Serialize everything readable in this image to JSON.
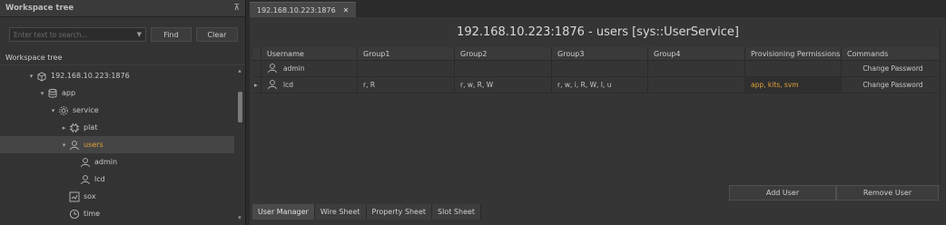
{
  "left_panel": {
    "title": "Workspace tree",
    "pin_icon": "pin-icon",
    "search": {
      "placeholder": "Enter text to search...",
      "find_label": "Find",
      "clear_label": "Clear"
    },
    "tree_header": "Workspace tree",
    "tree": [
      {
        "label": "192.168.10.223:1876",
        "icon": "device-icon",
        "expanded": true,
        "level": 0
      },
      {
        "label": "app",
        "icon": "database-icon",
        "expanded": true,
        "level": 1
      },
      {
        "label": "service",
        "icon": "gear-icon",
        "expanded": true,
        "level": 2
      },
      {
        "label": "plat",
        "icon": "chip-icon",
        "expanded": false,
        "level": 3
      },
      {
        "label": "users",
        "icon": "user-icon",
        "expanded": true,
        "level": 3,
        "selected": true
      },
      {
        "label": "admin",
        "icon": "user-icon",
        "level": 4
      },
      {
        "label": "lcd",
        "icon": "user-icon",
        "level": 4
      },
      {
        "label": "sox",
        "icon": "sox-icon",
        "level": 3
      },
      {
        "label": "time",
        "icon": "clock-icon",
        "level": 3
      }
    ]
  },
  "right_panel": {
    "tab_label": "192.168.10.223:1876",
    "page_title": "192.168.10.223:1876 - users [sys::UserService]",
    "columns": [
      "Username",
      "Group1",
      "Group2",
      "Group3",
      "Group4",
      "Provisioning Permissions",
      "Commands"
    ],
    "rows": [
      {
        "username": "admin",
        "group1": "",
        "group2": "",
        "group3": "",
        "group4": "",
        "permissions": "",
        "command": "Change Password"
      },
      {
        "username": "lcd",
        "group1": "r, R",
        "group2": "r, w, R, W",
        "group3": "r, w, i, R, W, I, u",
        "group4": "",
        "permissions": "app, kits, svm",
        "command": "Change Password"
      }
    ],
    "add_user_label": "Add User",
    "remove_user_label": "Remove User",
    "bottom_tabs": [
      "User Manager",
      "Wire Sheet",
      "Property Sheet",
      "Slot Sheet"
    ]
  },
  "colors": {
    "accent_orange": "#e2a13a",
    "background": "#2b2b2b"
  }
}
